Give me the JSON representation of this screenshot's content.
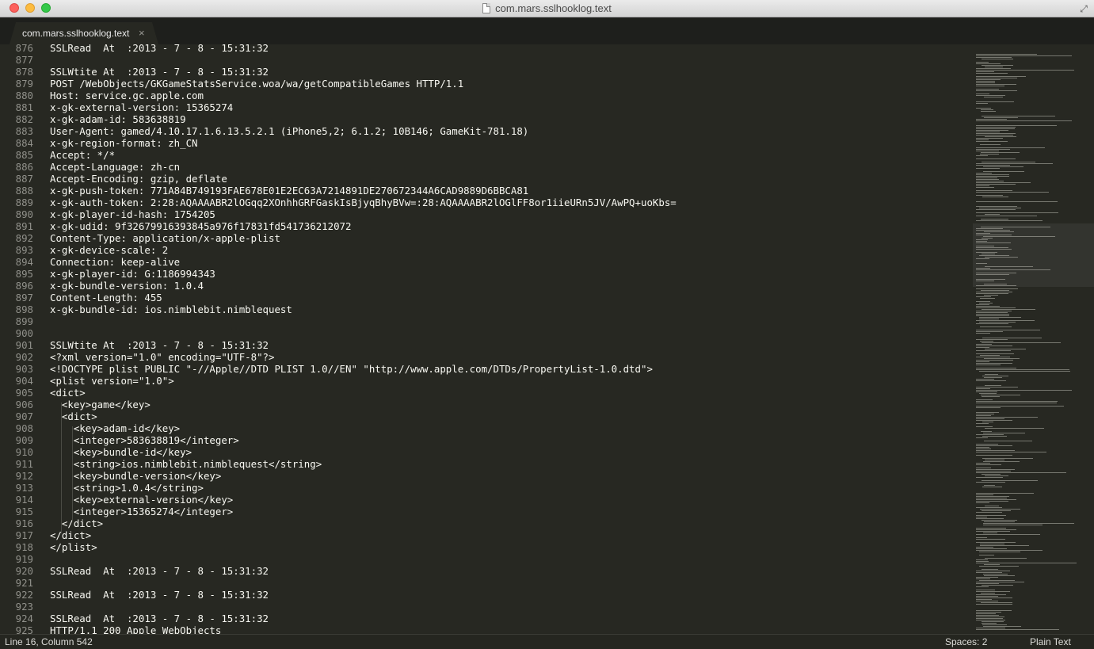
{
  "window": {
    "title": "com.mars.sslhooklog.text"
  },
  "tab": {
    "label": "com.mars.sslhooklog.text",
    "close_glyph": "×"
  },
  "icons": {
    "close": "close-traffic-light",
    "minimize": "minimize-traffic-light",
    "zoom": "zoom-traffic-light",
    "document": "document-icon",
    "fullscreen": "fullscreen-icon"
  },
  "colors": {
    "background": "#272822",
    "text": "#f8f8f2",
    "line_numbers": "#90908a",
    "tab_bar": "#1e1f1c"
  },
  "editor": {
    "lines": [
      {
        "n": "876",
        "t": "SSLRead  At  :2013 - 7 - 8 - 15:31:32"
      },
      {
        "n": "877",
        "t": ""
      },
      {
        "n": "878",
        "t": "SSLWtite At  :2013 - 7 - 8 - 15:31:32"
      },
      {
        "n": "879",
        "t": "POST /WebObjects/GKGameStatsService.woa/wa/getCompatibleGames HTTP/1.1"
      },
      {
        "n": "880",
        "t": "Host: service.gc.apple.com"
      },
      {
        "n": "881",
        "t": "x-gk-external-version: 15365274"
      },
      {
        "n": "882",
        "t": "x-gk-adam-id: 583638819"
      },
      {
        "n": "883",
        "t": "User-Agent: gamed/4.10.17.1.6.13.5.2.1 (iPhone5,2; 6.1.2; 10B146; GameKit-781.18)"
      },
      {
        "n": "884",
        "t": "x-gk-region-format: zh_CN"
      },
      {
        "n": "885",
        "t": "Accept: */*"
      },
      {
        "n": "886",
        "t": "Accept-Language: zh-cn"
      },
      {
        "n": "887",
        "t": "Accept-Encoding: gzip, deflate"
      },
      {
        "n": "888",
        "t": "x-gk-push-token: 771A84B749193FAE678E01E2EC63A7214891DE270672344A6CAD9889D6BBCA81"
      },
      {
        "n": "889",
        "t": "x-gk-auth-token: 2:28:AQAAAABR2lOGqq2XOnhhGRFGaskIsBjyqBhyBVw=:28:AQAAAABR2lOGlFF8or1iieURn5JV/AwPQ+uoKbs="
      },
      {
        "n": "890",
        "t": "x-gk-player-id-hash: 1754205"
      },
      {
        "n": "891",
        "t": "x-gk-udid: 9f32679916393845a976f17831fd541736212072"
      },
      {
        "n": "892",
        "t": "Content-Type: application/x-apple-plist"
      },
      {
        "n": "893",
        "t": "x-gk-device-scale: 2"
      },
      {
        "n": "894",
        "t": "Connection: keep-alive"
      },
      {
        "n": "895",
        "t": "x-gk-player-id: G:1186994343"
      },
      {
        "n": "896",
        "t": "x-gk-bundle-version: 1.0.4"
      },
      {
        "n": "897",
        "t": "Content-Length: 455"
      },
      {
        "n": "898",
        "t": "x-gk-bundle-id: ios.nimblebit.nimblequest"
      },
      {
        "n": "899",
        "t": ""
      },
      {
        "n": "900",
        "t": ""
      },
      {
        "n": "901",
        "t": "SSLWtite At  :2013 - 7 - 8 - 15:31:32"
      },
      {
        "n": "902",
        "t": "<?xml version=\"1.0\" encoding=\"UTF-8\"?>"
      },
      {
        "n": "903",
        "t": "<!DOCTYPE plist PUBLIC \"-//Apple//DTD PLIST 1.0//EN\" \"http://www.apple.com/DTDs/PropertyList-1.0.dtd\">"
      },
      {
        "n": "904",
        "t": "<plist version=\"1.0\">"
      },
      {
        "n": "905",
        "t": "<dict>"
      },
      {
        "n": "906",
        "t": "  <key>game</key>"
      },
      {
        "n": "907",
        "t": "  <dict>"
      },
      {
        "n": "908",
        "t": "    <key>adam-id</key>"
      },
      {
        "n": "909",
        "t": "    <integer>583638819</integer>"
      },
      {
        "n": "910",
        "t": "    <key>bundle-id</key>"
      },
      {
        "n": "911",
        "t": "    <string>ios.nimblebit.nimblequest</string>"
      },
      {
        "n": "912",
        "t": "    <key>bundle-version</key>"
      },
      {
        "n": "913",
        "t": "    <string>1.0.4</string>"
      },
      {
        "n": "914",
        "t": "    <key>external-version</key>"
      },
      {
        "n": "915",
        "t": "    <integer>15365274</integer>"
      },
      {
        "n": "916",
        "t": "  </dict>"
      },
      {
        "n": "917",
        "t": "</dict>"
      },
      {
        "n": "918",
        "t": "</plist>"
      },
      {
        "n": "919",
        "t": ""
      },
      {
        "n": "920",
        "t": "SSLRead  At  :2013 - 7 - 8 - 15:31:32"
      },
      {
        "n": "921",
        "t": ""
      },
      {
        "n": "922",
        "t": "SSLRead  At  :2013 - 7 - 8 - 15:31:32"
      },
      {
        "n": "923",
        "t": ""
      },
      {
        "n": "924",
        "t": "SSLRead  At  :2013 - 7 - 8 - 15:31:32"
      },
      {
        "n": "925",
        "t": "HTTP/1.1 200 Apple WebObjects"
      }
    ]
  },
  "status": {
    "position": "Line 16, Column 542",
    "indentation": "Spaces: 2",
    "syntax": "Plain Text"
  }
}
